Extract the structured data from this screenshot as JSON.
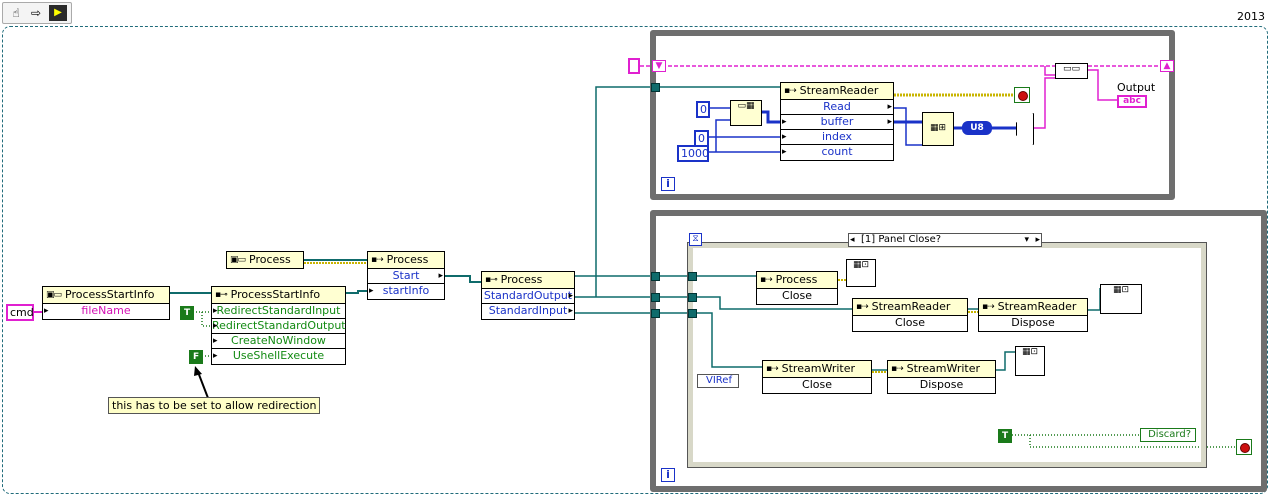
{
  "toolbar": {
    "year": "2013"
  },
  "constants": {
    "cmd": "cmd",
    "true1": "T",
    "false1": "F",
    "zero1": "0",
    "zero2": "0",
    "thousand": "1000",
    "true2": "T",
    "u8": "U8"
  },
  "nodes": {
    "psi_ctor": {
      "title": "ProcessStartInfo",
      "rows": [
        "fileName"
      ]
    },
    "psi_prop": {
      "title": "ProcessStartInfo",
      "rows": [
        "RedirectStandardInput",
        "RedirectStandardOutput",
        "CreateNoWindow",
        "UseShellExecute"
      ]
    },
    "process_const": {
      "title": "Process"
    },
    "process_invoke": {
      "title": "Process",
      "rows": [
        "Start",
        "startInfo"
      ]
    },
    "process_prop": {
      "title": "Process",
      "rows": [
        "StandardOutput",
        "StandardInput"
      ]
    },
    "stream_reader": {
      "title": "StreamReader",
      "rows": [
        "Read",
        "buffer",
        "index",
        "count"
      ]
    },
    "process_close": {
      "title": "Process",
      "rows": [
        "Close"
      ]
    },
    "sr_close": {
      "title": "StreamReader",
      "rows": [
        "Close"
      ]
    },
    "sr_dispose": {
      "title": "StreamReader",
      "rows": [
        "Dispose"
      ]
    },
    "sw_close": {
      "title": "StreamWriter",
      "rows": [
        "Close"
      ]
    },
    "sw_dispose": {
      "title": "StreamWriter",
      "rows": [
        "Dispose"
      ]
    }
  },
  "labels": {
    "comment": "this has to be set to allow redirection",
    "output": "Output",
    "output_ind": "abc",
    "case_selector": "[1] Panel Close?",
    "viref": "VIRef",
    "discard": "Discard?",
    "iter1": "i",
    "iter2": "i"
  },
  "colors": {
    "refnum_wire": "#0f6b6b",
    "string_wire": "#e020d0",
    "int_wire": "#1a32c8",
    "bool_wire": "#1a7a1a",
    "error_wire": "#c8b400",
    "loop_border": "#6e6e6e"
  }
}
